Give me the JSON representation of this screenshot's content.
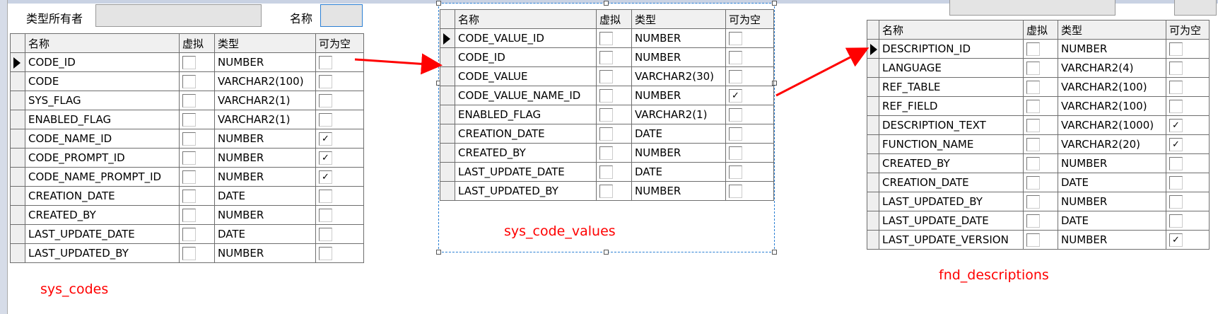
{
  "headers": {
    "name": "名称",
    "virtual": "虚拟",
    "type": "类型",
    "nullable": "可为空"
  },
  "filter": {
    "owner_label": "类型所有者",
    "owner_value": "",
    "name_label": "名称",
    "name_value": ""
  },
  "tables": [
    {
      "label": "sys_codes",
      "rows": [
        {
          "name": "CODE_ID",
          "virtual": false,
          "type": "NUMBER",
          "nullable": false
        },
        {
          "name": "CODE",
          "virtual": false,
          "type": "VARCHAR2(100)",
          "nullable": false
        },
        {
          "name": "SYS_FLAG",
          "virtual": false,
          "type": "VARCHAR2(1)",
          "nullable": false
        },
        {
          "name": "ENABLED_FLAG",
          "virtual": false,
          "type": "VARCHAR2(1)",
          "nullable": false
        },
        {
          "name": "CODE_NAME_ID",
          "virtual": false,
          "type": "NUMBER",
          "nullable": true
        },
        {
          "name": "CODE_PROMPT_ID",
          "virtual": false,
          "type": "NUMBER",
          "nullable": true
        },
        {
          "name": "CODE_NAME_PROMPT_ID",
          "virtual": false,
          "type": "NUMBER",
          "nullable": true
        },
        {
          "name": "CREATION_DATE",
          "virtual": false,
          "type": "DATE",
          "nullable": false
        },
        {
          "name": "CREATED_BY",
          "virtual": false,
          "type": "NUMBER",
          "nullable": false
        },
        {
          "name": "LAST_UPDATE_DATE",
          "virtual": false,
          "type": "DATE",
          "nullable": false
        },
        {
          "name": "LAST_UPDATED_BY",
          "virtual": false,
          "type": "NUMBER",
          "nullable": false
        }
      ]
    },
    {
      "label": "sys_code_values",
      "rows": [
        {
          "name": "CODE_VALUE_ID",
          "virtual": false,
          "type": "NUMBER",
          "nullable": false
        },
        {
          "name": "CODE_ID",
          "virtual": false,
          "type": "NUMBER",
          "nullable": false
        },
        {
          "name": "CODE_VALUE",
          "virtual": false,
          "type": "VARCHAR2(30)",
          "nullable": false
        },
        {
          "name": "CODE_VALUE_NAME_ID",
          "virtual": false,
          "type": "NUMBER",
          "nullable": true
        },
        {
          "name": "ENABLED_FLAG",
          "virtual": false,
          "type": "VARCHAR2(1)",
          "nullable": false
        },
        {
          "name": "CREATION_DATE",
          "virtual": false,
          "type": "DATE",
          "nullable": false
        },
        {
          "name": "CREATED_BY",
          "virtual": false,
          "type": "NUMBER",
          "nullable": false
        },
        {
          "name": "LAST_UPDATE_DATE",
          "virtual": false,
          "type": "DATE",
          "nullable": false
        },
        {
          "name": "LAST_UPDATED_BY",
          "virtual": false,
          "type": "NUMBER",
          "nullable": false
        }
      ]
    },
    {
      "label": "fnd_descriptions",
      "rows": [
        {
          "name": "DESCRIPTION_ID",
          "virtual": false,
          "type": "NUMBER",
          "nullable": false
        },
        {
          "name": "LANGUAGE",
          "virtual": false,
          "type": "VARCHAR2(4)",
          "nullable": false
        },
        {
          "name": "REF_TABLE",
          "virtual": false,
          "type": "VARCHAR2(100)",
          "nullable": false
        },
        {
          "name": "REF_FIELD",
          "virtual": false,
          "type": "VARCHAR2(100)",
          "nullable": false
        },
        {
          "name": "DESCRIPTION_TEXT",
          "virtual": false,
          "type": "VARCHAR2(1000)",
          "nullable": true
        },
        {
          "name": "FUNCTION_NAME",
          "virtual": false,
          "type": "VARCHAR2(20)",
          "nullable": true
        },
        {
          "name": "CREATED_BY",
          "virtual": false,
          "type": "NUMBER",
          "nullable": false
        },
        {
          "name": "CREATION_DATE",
          "virtual": false,
          "type": "DATE",
          "nullable": false
        },
        {
          "name": "LAST_UPDATED_BY",
          "virtual": false,
          "type": "NUMBER",
          "nullable": false
        },
        {
          "name": "LAST_UPDATE_DATE",
          "virtual": false,
          "type": "DATE",
          "nullable": false
        },
        {
          "name": "LAST_UPDATE_VERSION",
          "virtual": false,
          "type": "NUMBER",
          "nullable": true
        }
      ]
    }
  ],
  "colors": {
    "annotation": "#ff0000",
    "selection": "#2a7fd4"
  }
}
